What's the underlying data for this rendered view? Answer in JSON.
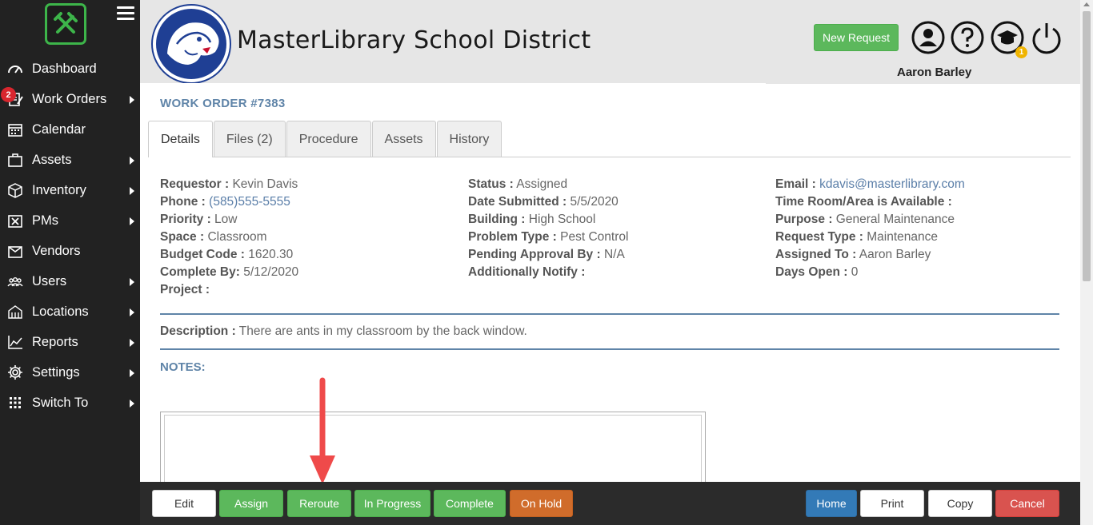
{
  "sidebar": {
    "items": [
      {
        "label": "Dashboard",
        "icon": "dashboard-icon",
        "has_submenu": false
      },
      {
        "label": "Work Orders",
        "icon": "work-orders-icon",
        "has_submenu": true,
        "badge": "2"
      },
      {
        "label": "Calendar",
        "icon": "calendar-icon",
        "has_submenu": false
      },
      {
        "label": "Assets",
        "icon": "assets-icon",
        "has_submenu": true
      },
      {
        "label": "Inventory",
        "icon": "inventory-icon",
        "has_submenu": true
      },
      {
        "label": "PMs",
        "icon": "pms-icon",
        "has_submenu": true
      },
      {
        "label": "Vendors",
        "icon": "vendors-icon",
        "has_submenu": false
      },
      {
        "label": "Users",
        "icon": "users-icon",
        "has_submenu": true
      },
      {
        "label": "Locations",
        "icon": "locations-icon",
        "has_submenu": true
      },
      {
        "label": "Reports",
        "icon": "reports-icon",
        "has_submenu": true
      },
      {
        "label": "Settings",
        "icon": "settings-icon",
        "has_submenu": true
      },
      {
        "label": "Switch To",
        "icon": "switch-to-icon",
        "has_submenu": true
      }
    ]
  },
  "header": {
    "site_title": "MasterLibrary School District",
    "new_request_label": "New Request",
    "user_name": "Aaron Barley",
    "notification_badge": "1"
  },
  "work_order": {
    "title": "WORK ORDER #7383",
    "tabs": [
      "Details",
      "Files (2)",
      "Procedure",
      "Assets",
      "History"
    ],
    "active_tab": "Details",
    "columns": [
      [
        {
          "label": "Requestor :",
          "value": "Kevin Davis"
        },
        {
          "label": "Phone :",
          "value": "(585)555-5555",
          "link": true
        },
        {
          "label": "Priority :",
          "value": "Low"
        },
        {
          "label": "Space :",
          "value": "Classroom"
        },
        {
          "label": "Budget Code :",
          "value": "1620.30"
        },
        {
          "label": "Complete By:",
          "value": "5/12/2020"
        },
        {
          "label": "Project :",
          "value": ""
        }
      ],
      [
        {
          "label": "Status :",
          "value": "Assigned"
        },
        {
          "label": "Date Submitted :",
          "value": "5/5/2020"
        },
        {
          "label": "Building :",
          "value": "High School"
        },
        {
          "label": "Problem Type :",
          "value": "Pest Control"
        },
        {
          "label": "Pending Approval By :",
          "value": "N/A"
        },
        {
          "label": "Additionally Notify :",
          "value": ""
        }
      ],
      [
        {
          "label": "Email :",
          "value": "kdavis@masterlibrary.com",
          "link": true
        },
        {
          "label": "Time Room/Area is Available :",
          "value": ""
        },
        {
          "label": "Purpose :",
          "value": "General Maintenance"
        },
        {
          "label": "Request Type :",
          "value": "Maintenance"
        },
        {
          "label": "Assigned To :",
          "value": "Aaron Barley"
        },
        {
          "label": "Days Open :",
          "value": "0"
        }
      ]
    ],
    "description_label": "Description :",
    "description": "There are ants in my classroom by the back window.",
    "notes_label": "NOTES:"
  },
  "footer": {
    "buttons": [
      {
        "label": "Edit",
        "style": "white"
      },
      {
        "label": "Assign",
        "style": "green"
      },
      {
        "label": "Reroute",
        "style": "green"
      },
      {
        "label": "In Progress",
        "style": "green"
      },
      {
        "label": "Complete",
        "style": "green"
      },
      {
        "label": "On Hold",
        "style": "orange"
      },
      {
        "label": "Home",
        "style": "blue"
      },
      {
        "label": "Print",
        "style": "white"
      },
      {
        "label": "Copy",
        "style": "white"
      },
      {
        "label": "Cancel",
        "style": "red"
      }
    ]
  },
  "colors": {
    "sidebar_bg": "#222222",
    "accent_blue": "#5f84a8",
    "green": "#5cb85c",
    "orange": "#d06c2b",
    "annotation_arrow": "#ef4a4a"
  }
}
